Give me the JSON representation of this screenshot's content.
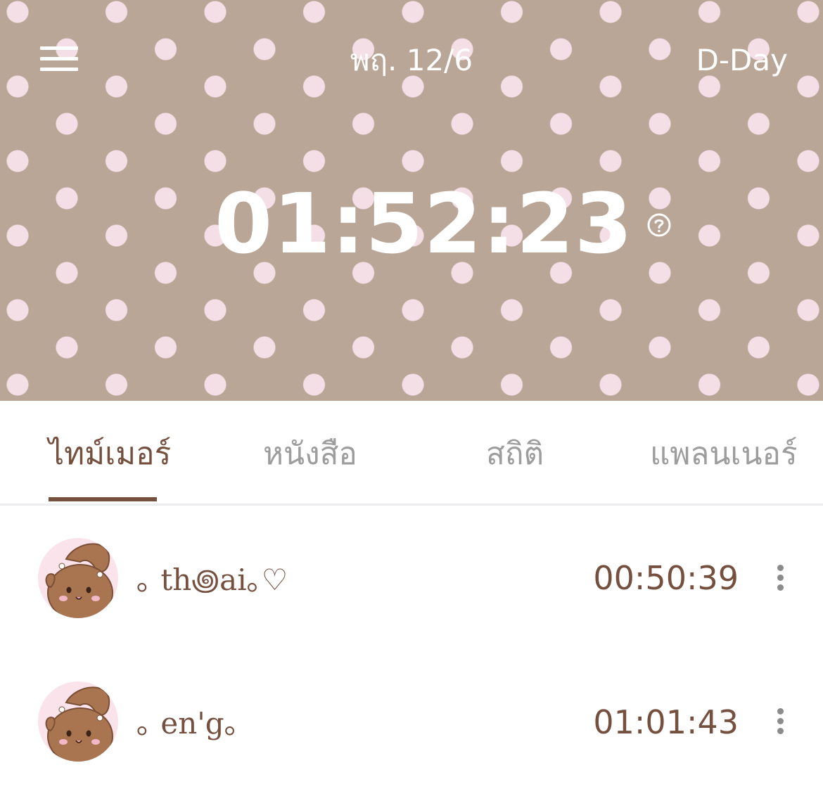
{
  "header": {
    "date": "พฤ. 12/6",
    "dday_label": "D-Day",
    "total_time": "01:52:23"
  },
  "colors": {
    "header_bg": "#b9a697",
    "dot": "#f4dfe6",
    "accent": "#75503f",
    "inactive_tab": "#9d9d9d",
    "avatar_bg": "#fbe3ec",
    "avatar_bunny": "#a97551"
  },
  "tabs": [
    {
      "label": "ไทม์เมอร์",
      "active": true
    },
    {
      "label": "หนังสือ",
      "active": false
    },
    {
      "label": "สถิติ",
      "active": false
    },
    {
      "label": "แพลนเนอร์",
      "active": false
    }
  ],
  "subjects": [
    {
      "name": "｡ th꩜ai｡♡",
      "time": "00:50:39",
      "icon": "bunny-avatar-icon"
    },
    {
      "name": "｡ en'g｡",
      "time": "01:01:43",
      "icon": "bunny-avatar-icon"
    }
  ]
}
